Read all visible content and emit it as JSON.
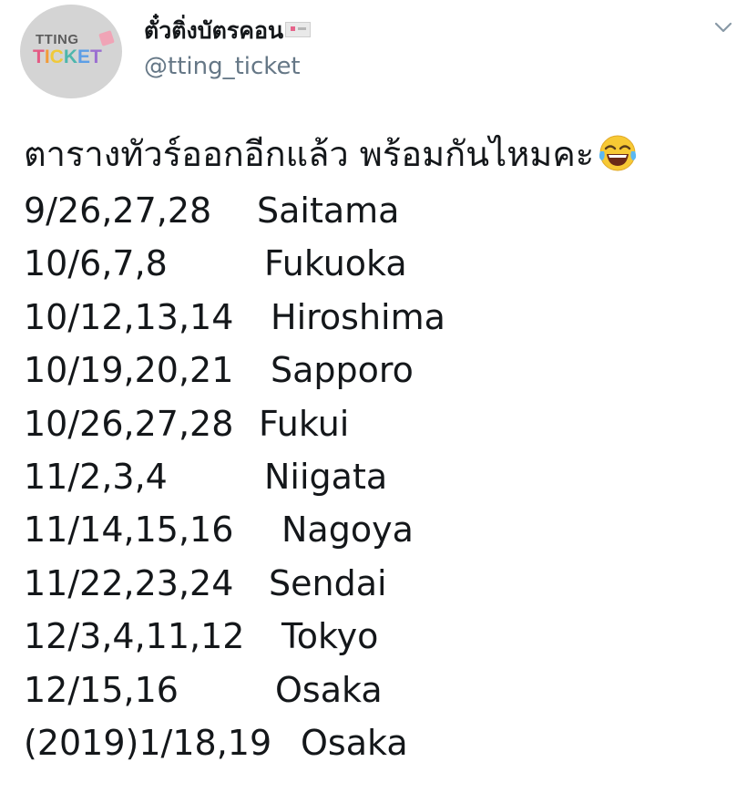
{
  "header": {
    "display_name": "ตั๋วติ่งบัตรคอน",
    "handle": "@tting_ticket",
    "avatar_logo_top": "TTING",
    "avatar_logo_bottom": [
      "T",
      "I",
      "C",
      "K",
      "E",
      "T"
    ]
  },
  "tweet": {
    "intro_text": "ตารางทัวร์ออกอีกแล้ว พร้อมกันไหมคะ",
    "emoji": "face-with-tears-of-joy",
    "schedule": [
      {
        "date": "9/26,27,28",
        "city": "Saitama"
      },
      {
        "date": "10/6,7,8",
        "city": "Fukuoka"
      },
      {
        "date": "10/12,13,14",
        "city": "Hiroshima"
      },
      {
        "date": "10/19,20,21",
        "city": "Sapporo"
      },
      {
        "date": "10/26,27,28",
        "city": "Fukui"
      },
      {
        "date": "11/2,3,4",
        "city": "Niigata"
      },
      {
        "date": "11/14,15,16",
        "city": "Nagoya"
      },
      {
        "date": "11/22,23,24",
        "city": "Sendai"
      },
      {
        "date": "12/3,4,11,12",
        "city": "Tokyo"
      },
      {
        "date": "12/15,16",
        "city": "Osaka"
      },
      {
        "date": "(2019)1/18,19",
        "city": "Osaka"
      }
    ]
  },
  "colors": {
    "text": "#14171a",
    "handle": "#657786",
    "logo_letters": [
      "#e45a84",
      "#f29b38",
      "#f0c93a",
      "#4db6ac",
      "#5c9ee6",
      "#9b6fd1"
    ]
  }
}
